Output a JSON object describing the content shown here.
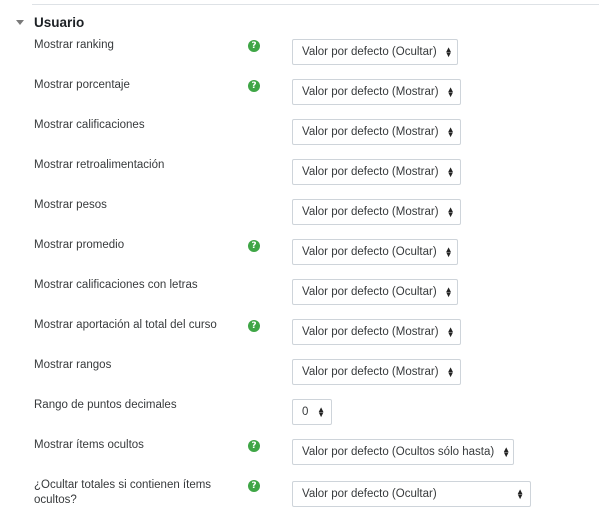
{
  "section": {
    "title": "Usuario",
    "collapse_icon": "caret-down-icon"
  },
  "help_icon": {
    "glyph": "?",
    "color": "#3fa646"
  },
  "select_icon": {
    "up": "▲",
    "down": "▼"
  },
  "settings": [
    {
      "label": "Mostrar ranking",
      "help": true,
      "value": "Valor por defecto (Ocultar)"
    },
    {
      "label": "Mostrar porcentaje",
      "help": true,
      "value": "Valor por defecto (Mostrar)"
    },
    {
      "label": "Mostrar calificaciones",
      "help": false,
      "value": "Valor por defecto (Mostrar)"
    },
    {
      "label": "Mostrar retroalimentación",
      "help": false,
      "value": "Valor por defecto (Mostrar)"
    },
    {
      "label": "Mostrar pesos",
      "help": false,
      "value": "Valor por defecto (Mostrar)"
    },
    {
      "label": "Mostrar promedio",
      "help": true,
      "value": "Valor por defecto (Ocultar)"
    },
    {
      "label": "Mostrar calificaciones con letras",
      "help": false,
      "value": "Valor por defecto (Ocultar)"
    },
    {
      "label": "Mostrar aportación al total del curso",
      "help": true,
      "value": "Valor por defecto (Mostrar)"
    },
    {
      "label": "Mostrar rangos",
      "help": false,
      "value": "Valor por defecto (Mostrar)"
    },
    {
      "label": "Rango de puntos decimales",
      "help": false,
      "value": "0"
    },
    {
      "label": "Mostrar ítems ocultos",
      "help": true,
      "value": "Valor por defecto (Ocultos sólo hasta)"
    },
    {
      "label": "¿Ocultar totales si contienen ítems ocultos?",
      "help": true,
      "value": "Valor por defecto (Ocultar)"
    }
  ]
}
